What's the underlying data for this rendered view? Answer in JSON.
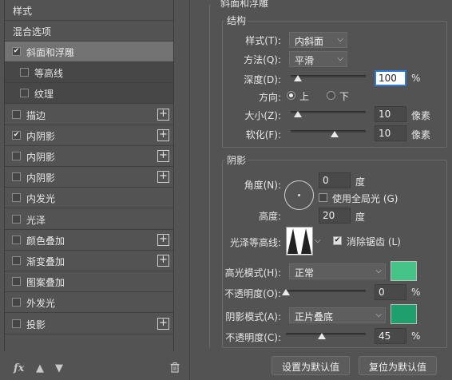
{
  "layers_panel": {
    "header": "样式",
    "blend_options": "混合选项",
    "items": [
      {
        "label": "斜面和浮雕",
        "checked": true,
        "plus": false
      },
      {
        "label": "等高线",
        "checked": false,
        "plus": false
      },
      {
        "label": "纹理",
        "checked": false,
        "plus": false
      },
      {
        "label": "描边",
        "checked": false,
        "plus": true
      },
      {
        "label": "内阴影",
        "checked": true,
        "plus": true
      },
      {
        "label": "内阴影",
        "checked": false,
        "plus": true
      },
      {
        "label": "内阴影",
        "checked": false,
        "plus": true
      },
      {
        "label": "内发光",
        "checked": false,
        "plus": false
      },
      {
        "label": "光泽",
        "checked": false,
        "plus": false
      },
      {
        "label": "颜色叠加",
        "checked": false,
        "plus": true
      },
      {
        "label": "渐变叠加",
        "checked": false,
        "plus": true
      },
      {
        "label": "图案叠加",
        "checked": false,
        "plus": false
      },
      {
        "label": "外发光",
        "checked": false,
        "plus": false
      },
      {
        "label": "投影",
        "checked": false,
        "plus": true
      }
    ],
    "fx_label": "fx",
    "icons": [
      "fx-icon",
      "move-up-icon",
      "move-down-icon",
      "trash-icon"
    ]
  },
  "bevel": {
    "group_title": "斜面和浮雕",
    "structure_title": "结构",
    "style_label": "样式(T):",
    "style_value": "内斜面",
    "method_label": "方法(Q):",
    "method_value": "平滑",
    "depth_label": "深度(D):",
    "depth_value": "100",
    "depth_unit": "%",
    "depth_level": 0.1,
    "direction_label": "方向:",
    "direction_up": "上",
    "direction_down": "下",
    "size_label": "大小(Z):",
    "size_value": "10",
    "size_unit": "像素",
    "size_level": 0.1,
    "soften_label": "软化(F):",
    "soften_value": "10",
    "soften_unit": "像素",
    "soften_level": 0.58
  },
  "shading": {
    "title": "阴影",
    "angle_label": "角度(N):",
    "angle_value": "0",
    "angle_unit": "度",
    "global_light_label": "使用全局光 (G)",
    "altitude_label": "高度:",
    "altitude_value": "20",
    "altitude_unit": "度",
    "gloss_label": "光泽等高线:",
    "antialias_label": "消除锯齿 (L)",
    "antialias_checked": true,
    "highlight_mode_label": "高光模式(H):",
    "highlight_mode_value": "正常",
    "highlight_color": "#45c487",
    "highlight_opacity_label": "不透明度(O):",
    "highlight_opacity_value": "0",
    "highlight_opacity_unit": "%",
    "highlight_opacity_level": 0,
    "shadow_mode_label": "阴影模式(A):",
    "shadow_mode_value": "正片叠底",
    "shadow_color": "#1f9e6e",
    "shadow_opacity_label": "不透明度(C):",
    "shadow_opacity_value": "45",
    "shadow_opacity_unit": "%",
    "shadow_opacity_level": 0.45
  },
  "buttons": {
    "make_default": "设置为默认值",
    "reset_default": "复位为默认值"
  }
}
